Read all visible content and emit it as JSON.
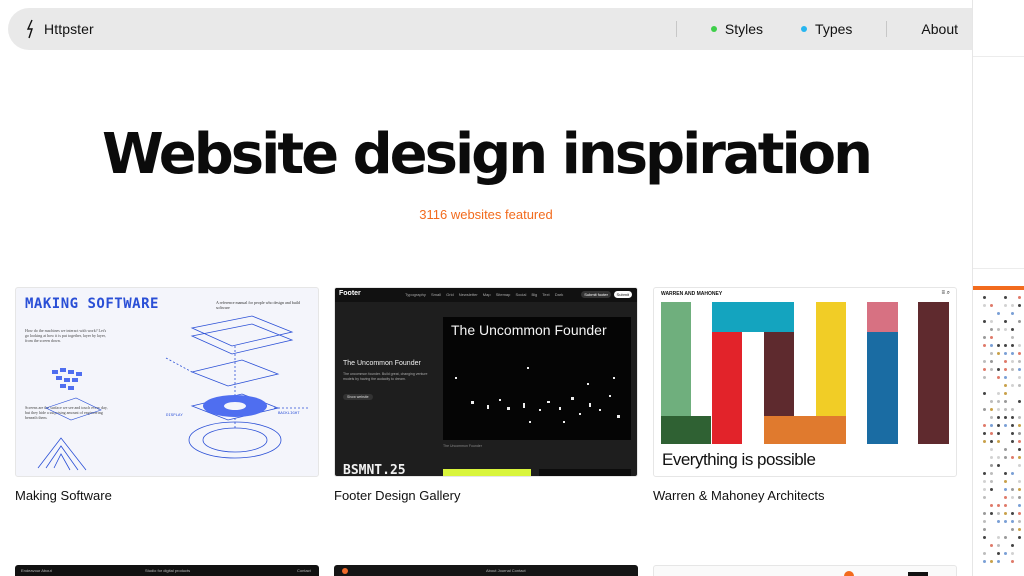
{
  "header": {
    "brand": "Httpster",
    "nav": [
      {
        "label": "Styles",
        "dot_color": "#3ecf4a"
      },
      {
        "label": "Types",
        "dot_color": "#27b6f0"
      },
      {
        "label": "About"
      }
    ]
  },
  "hero": {
    "title": "Website design inspiration",
    "count_text": "3116 websites featured",
    "count_color": "#f26b1d"
  },
  "cards": [
    {
      "title": "Making Software",
      "thumb": {
        "heading": "MAKING SOFTWARE",
        "deck": "A reference manual for people who design and build software",
        "body_1": "How do the machines we interact with work? Let's go looking at how it is put together, layer by layer, from the screen down.",
        "body_2": "Screens are the surface we see and touch every day, but they hide a surprising amount of engineering beneath them.",
        "label_a": "DISPLAY",
        "label_b": "BACKLIGHT"
      }
    },
    {
      "title": "Footer Design Gallery",
      "thumb": {
        "logo": "Footer",
        "menu": "Typography Small Grid Newsletter Map Sitemap Social Big Text Dark",
        "sub_btn": "Submit footer",
        "cta_btn": "Submit",
        "panel_title": "The Uncommon Founder",
        "heading": "The Uncommon Founder",
        "paragraph": "The uncommon founder. Build great, changing venture models by having the audacity to dream.",
        "pill": "Show website",
        "credit": "The Uncommon Founder",
        "bottom": "BSMNT.25"
      }
    },
    {
      "title": "Warren & Mahoney Architects",
      "thumb": {
        "brand": "WARREN AND MAHONEY",
        "icons": "≡ ⌕",
        "caption": "Everything is possible"
      }
    }
  ],
  "peeks": [
    {
      "left_text": "Endeavour   About",
      "mid_text": "Studio for digital products",
      "right_text": "Contact"
    },
    {
      "left_text": "",
      "mid_text": "About   Journal   Contact",
      "right_text": ""
    },
    {
      "left_text": "",
      "mid_text": "",
      "right_text": ""
    }
  ]
}
